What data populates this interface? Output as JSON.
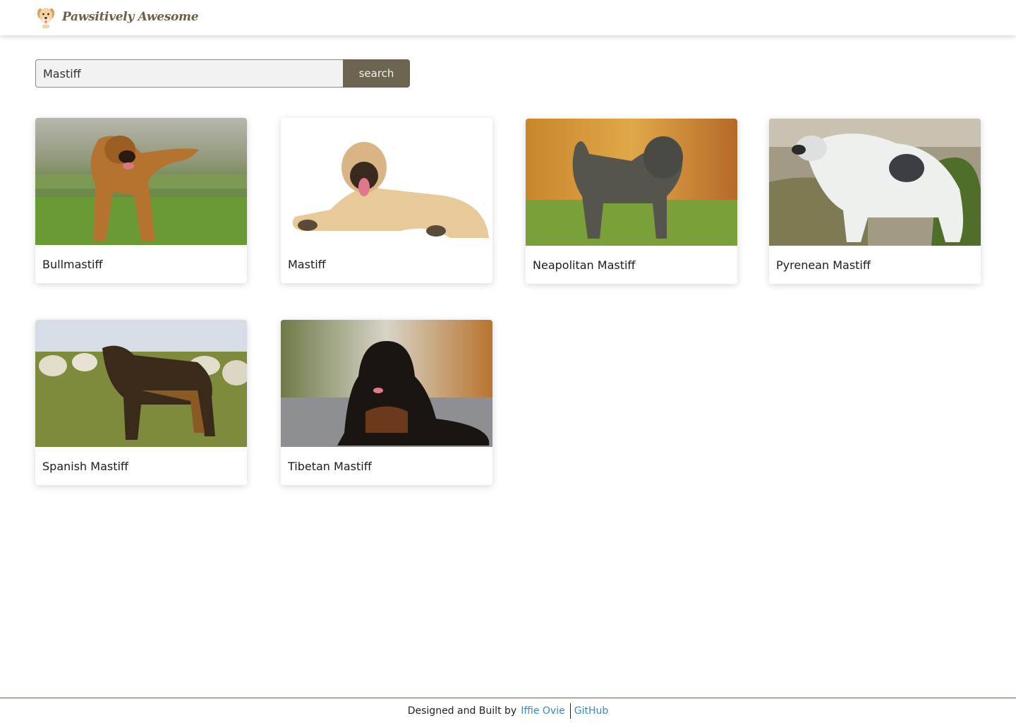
{
  "header": {
    "brand": "Pawsitively Awesome",
    "logo_icon": "dog-logo-icon"
  },
  "search": {
    "value": "Mastiff",
    "button_label": "search"
  },
  "cards": [
    {
      "name": "Bullmastiff"
    },
    {
      "name": "Mastiff"
    },
    {
      "name": "Neapolitan Mastiff"
    },
    {
      "name": "Pyrenean Mastiff"
    },
    {
      "name": "Spanish Mastiff"
    },
    {
      "name": "Tibetan Mastiff"
    }
  ],
  "footer": {
    "credit_text": "Designed and Built by",
    "author_link": "Iffie Ovie",
    "github_link": "GitHub"
  },
  "colors": {
    "accent": "#6b6451",
    "link": "#3d86c6"
  }
}
